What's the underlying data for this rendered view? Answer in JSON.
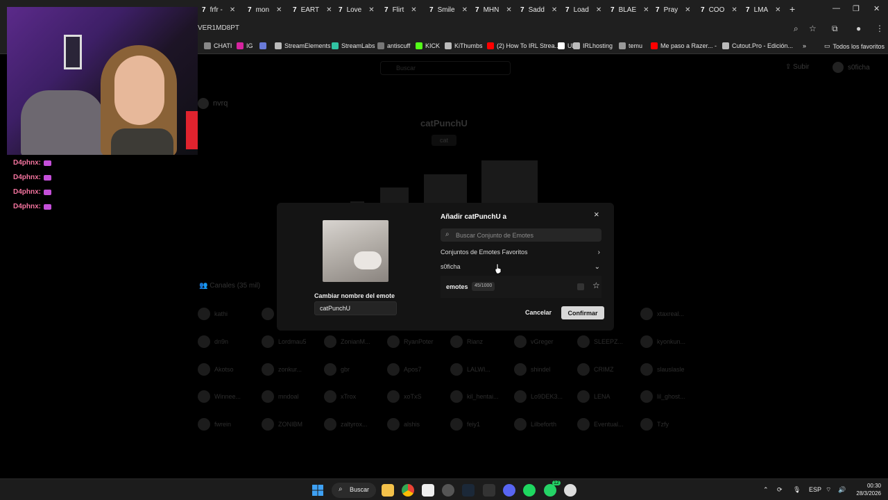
{
  "browser": {
    "tabs": [
      {
        "label": "frfr -"
      },
      {
        "label": "mon"
      },
      {
        "label": "EART"
      },
      {
        "label": "Love"
      },
      {
        "label": "Flirt"
      },
      {
        "label": "Smile"
      },
      {
        "label": "MHN"
      },
      {
        "label": "Sadd"
      },
      {
        "label": "Load"
      },
      {
        "label": "BLAE"
      },
      {
        "label": "Pray"
      },
      {
        "label": "COO"
      },
      {
        "label": "LMA"
      }
    ],
    "tab_favicon": "7",
    "url": "VER1MD8PT",
    "bookmarks": [
      {
        "label": "CHATI",
        "color": "#888888"
      },
      {
        "label": "IG",
        "color": "#d6249f"
      },
      {
        "label": "",
        "color": "#6a7bd9"
      },
      {
        "label": "StreamElements",
        "color": "#bbbbbb"
      },
      {
        "label": "StreamLabs",
        "color": "#31c3a2"
      },
      {
        "label": "antiscuff",
        "color": "#777777"
      },
      {
        "label": "KICK",
        "color": "#53fc18"
      },
      {
        "label": "KiThumbs",
        "color": "#bbbbbb"
      },
      {
        "label": "(2) How To IRL Strea...",
        "color": "#ff0000"
      },
      {
        "label": "UP",
        "color": "#ffffff"
      },
      {
        "label": "IRLhosting",
        "color": "#bbbbbb"
      },
      {
        "label": "temu",
        "color": "#999999"
      },
      {
        "label": "Me paso a Razer... -",
        "color": "#ff0000"
      },
      {
        "label": "Cutout.Pro - Edición...",
        "color": "#bbbbbb"
      }
    ],
    "bookmarks_overflow": "»",
    "all_bookmarks": "Todos los favoritos"
  },
  "page": {
    "search_placeholder": "Buscar",
    "upload_label": "Subir",
    "username": "s0ficha",
    "owner": "nvrq",
    "emote_name": "catPunchU",
    "emote_tag": "cat",
    "channels_label": "Canales (35 mil)",
    "channels": [
      [
        "kathi",
        "",
        "",
        "",
        "",
        "",
        "",
        "xtaxreal..."
      ],
      [
        "dn9n",
        "Lordmau5",
        "ZonianM...",
        "RyanPoter",
        "Rianz",
        "vGreger",
        "SLEEPZ...",
        "kyonkun..."
      ],
      [
        "Akotso",
        "zonkur...",
        "gbr",
        "Apos7",
        "LALWI...",
        "shindel",
        "CRIMZ",
        "slauslasle"
      ],
      [
        "Winnee...",
        "mndoal",
        "xTrox",
        "xoTxS",
        "kil_hentai...",
        "Lo9DEK3...",
        "LENA",
        "lil_ghost..."
      ],
      [
        "fwrein",
        "ZONIBM",
        "zaltyrox...",
        "alshis",
        "feiy1",
        "Lilbeforth",
        "Eventual...",
        "Tzfy"
      ]
    ]
  },
  "stream_chat": [
    {
      "user": "D4phnx:"
    },
    {
      "user": "D4phnx:"
    },
    {
      "user": "D4phnx:"
    },
    {
      "user": "D4phnx:"
    }
  ],
  "modal": {
    "title": "Añadir catPunchU a",
    "rename_label": "Cambiar nombre del emote",
    "rename_value": "catPunchU",
    "search_placeholder": "Buscar Conjunto de Emotes",
    "favorites_label": "Conjuntos de Emotes Favoritos",
    "user_section": "s0ficha",
    "sets": [
      {
        "name": "emotes",
        "count": "45/1000"
      }
    ],
    "cancel_label": "Cancelar",
    "confirm_label": "Confirmar",
    "close_icon": "×"
  },
  "taskbar": {
    "search_label": "Buscar",
    "language": "ESP",
    "time": "00:30",
    "date": "28/3/2026",
    "whatsapp_badge": "12"
  }
}
